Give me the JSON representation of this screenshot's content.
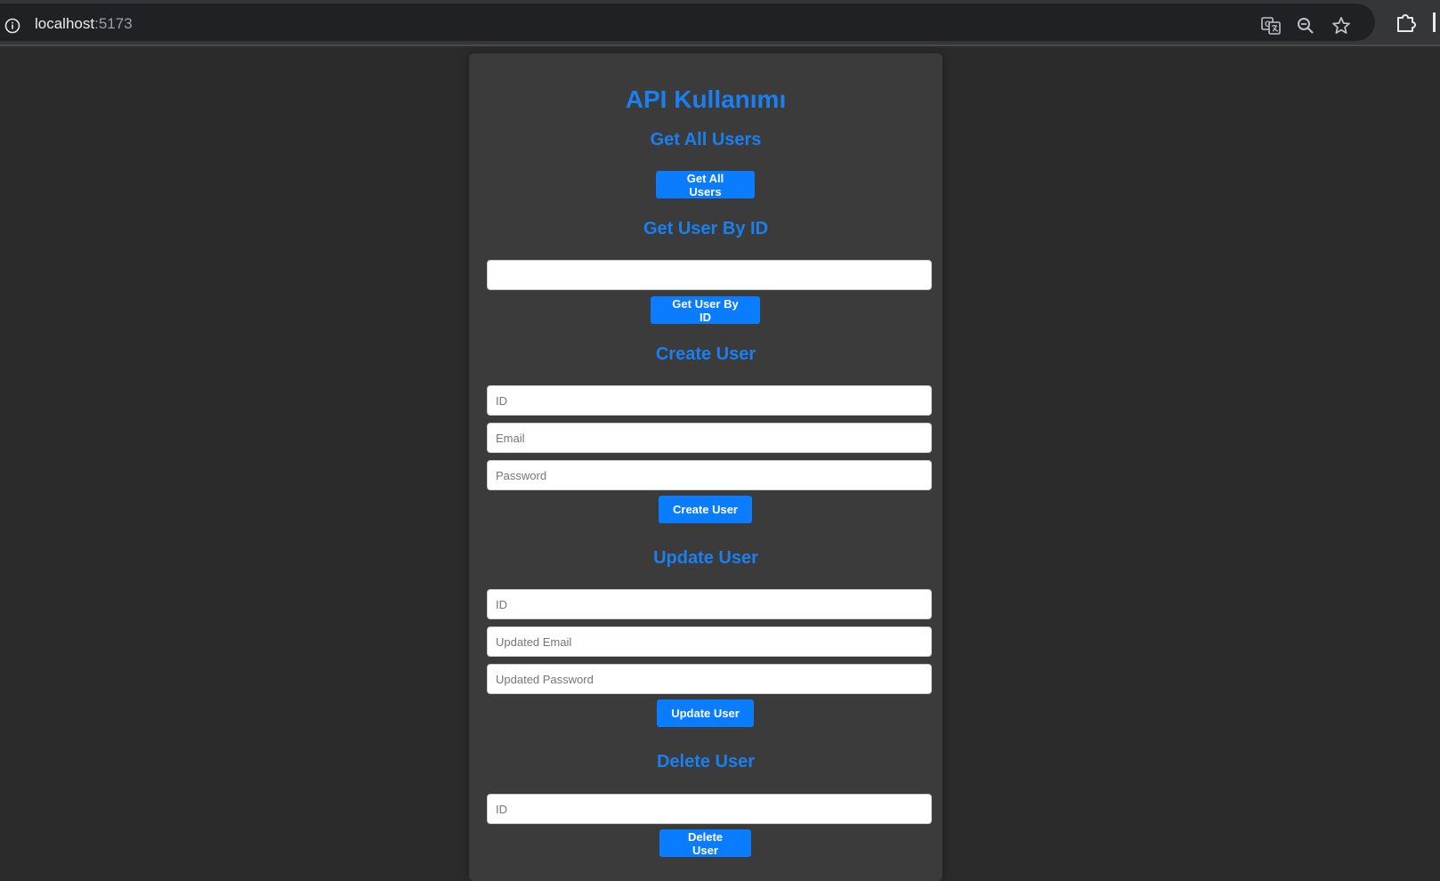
{
  "browser": {
    "host": "localhost",
    "port": ":5173"
  },
  "page": {
    "title": "API Kullanımı",
    "get_all": {
      "heading": "Get All Users",
      "button": "Get All Users"
    },
    "get_by_id": {
      "heading": "Get User By ID",
      "input_value": "",
      "input_placeholder": "",
      "button": "Get User By ID"
    },
    "create": {
      "heading": "Create User",
      "id_placeholder": "ID",
      "email_placeholder": "Email",
      "password_placeholder": "Password",
      "button": "Create User"
    },
    "update": {
      "heading": "Update User",
      "id_placeholder": "ID",
      "email_placeholder": "Updated Email",
      "password_placeholder": "Updated Password",
      "button": "Update User"
    },
    "delete": {
      "heading": "Delete User",
      "id_placeholder": "ID",
      "button": "Delete User"
    }
  },
  "colors": {
    "accent": "#0a7cff",
    "heading": "#1a7ff0",
    "card_bg": "#3b3b3b",
    "page_bg": "#2b2b2b"
  },
  "icons": [
    "info-icon",
    "translate-icon",
    "zoom-out-icon",
    "bookmark-star-icon",
    "extensions-icon"
  ]
}
